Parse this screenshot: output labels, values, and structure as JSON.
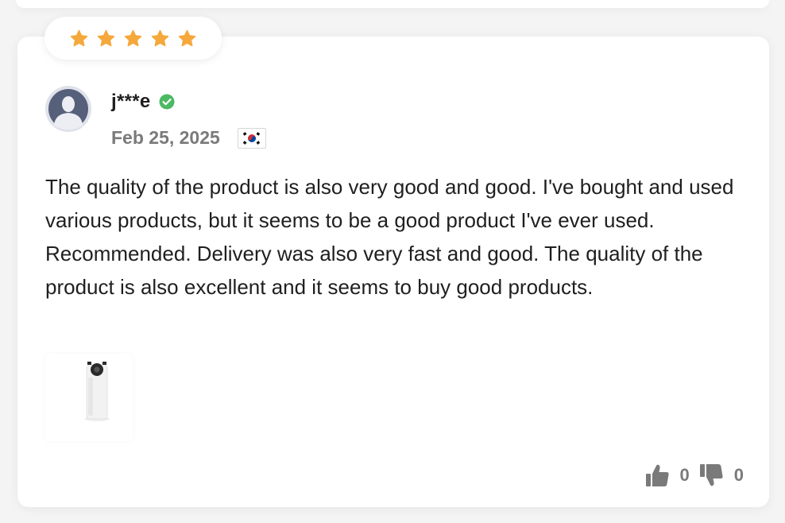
{
  "review": {
    "rating": 5,
    "max_rating": 5,
    "username": "j***e",
    "verified": true,
    "date": "Feb 25, 2025",
    "country_flag": "south-korea-flag-icon",
    "text": "The quality of the product is also very good and good. I've bought and used various products, but it seems to be a good product I've ever used. Recommended. Delivery was also very fast and good. The quality of the product is also excellent and it seems to buy good products.",
    "photo": "product-photo-thumbnail",
    "likes": "0",
    "dislikes": "0"
  },
  "colors": {
    "star": "#f5a83b",
    "verified": "#4cb964",
    "text": "#1f1f1f",
    "muted": "#7a7a7a",
    "card_bg": "#ffffff",
    "page_bg": "#f4f4f5"
  },
  "icons": {
    "star": "star-icon",
    "verified": "verified-check-icon",
    "avatar": "default-user-avatar-icon",
    "like": "thumbs-up-icon",
    "dislike": "thumbs-down-icon"
  }
}
